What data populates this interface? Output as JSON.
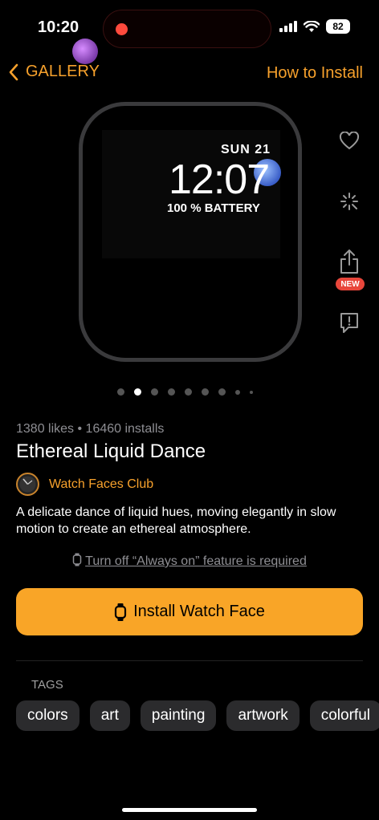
{
  "status": {
    "time": "10:20",
    "battery": "82"
  },
  "nav": {
    "back_label": "GALLERY",
    "how_to_install": "How to Install"
  },
  "watch_face": {
    "date": "SUN 21",
    "time": "12:07",
    "battery_text": "100 % BATTERY"
  },
  "side_actions": {
    "new_badge": "NEW"
  },
  "pager": {
    "total": 9,
    "active_index": 1
  },
  "face": {
    "stats": "1380 likes • 16460 installs",
    "title": "Ethereal Liquid Dance",
    "author": "Watch Faces Club",
    "description": "A delicate dance of liquid hues, moving elegantly in slow motion to create an ethereal atmosphere.",
    "notice": "Turn off “Always on” feature is required"
  },
  "install_button": "Install Watch Face",
  "tags_label": "TAGS",
  "tags": [
    "colors",
    "art",
    "painting",
    "artwork",
    "colorful"
  ],
  "colors": {
    "accent": "#f7a12c",
    "button": "#f9a527",
    "badge": "#e8463b"
  }
}
